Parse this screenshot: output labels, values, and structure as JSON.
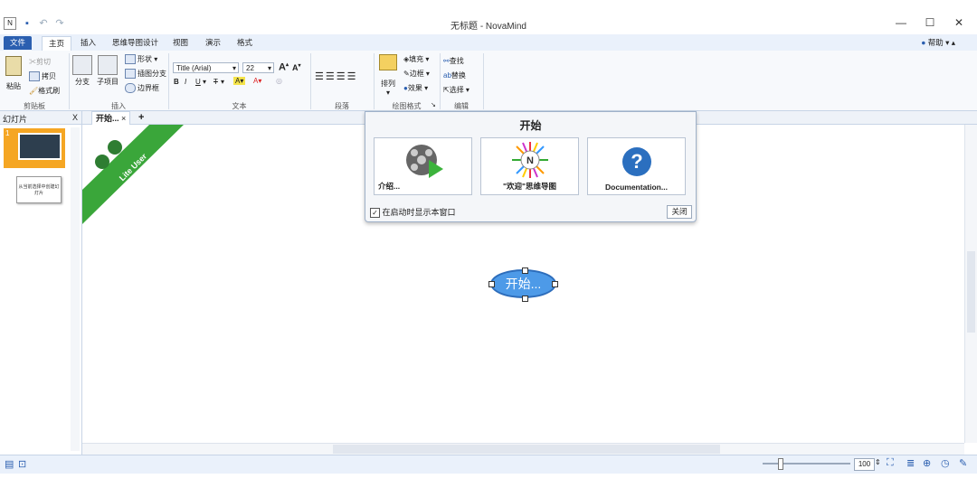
{
  "window": {
    "title": "无标题 - NovaMind"
  },
  "tabs": {
    "file": "文件",
    "home": "主页",
    "insert": "插入",
    "design": "思维导图设计",
    "view": "视图",
    "present": "演示",
    "format": "格式"
  },
  "help": "帮助",
  "clipboard": {
    "paste": "粘贴",
    "cut": "剪切",
    "copy": "拷贝",
    "format_painter": "格式刷",
    "group": "剪贴板"
  },
  "insert_grp": {
    "branch": "分支",
    "subitem": "子项目",
    "shape": "形状",
    "map_branch": "插图分支",
    "boundary": "边界框",
    "group": "插入"
  },
  "text_grp": {
    "font": "Title (Arial)",
    "size": "22",
    "bold": "B",
    "italic": "I",
    "underline": "U",
    "strike": "T",
    "group": "文本"
  },
  "paragraph_grp": {
    "group": "段落"
  },
  "draw_grp": {
    "arrange": "排列",
    "fill": "填充",
    "border": "边框",
    "effect": "效果",
    "group": "绘图格式"
  },
  "edit_grp": {
    "find": "查找",
    "replace": "替换",
    "select": "选择",
    "group": "编辑"
  },
  "left_panel": {
    "title": "幻灯片",
    "close": "X",
    "slide_num": "1",
    "thumb2_text": "从当前选择中创建幻灯片"
  },
  "doc_tab": {
    "label": "开始...",
    "close": "×",
    "add": "+"
  },
  "ribbon_banner": "Lite User",
  "start_dialog": {
    "title": "开始",
    "cards": [
      {
        "label": "介绍..."
      },
      {
        "label": "\"欢迎\"思维导图"
      },
      {
        "label": "Documentation..."
      }
    ],
    "checkbox_label": "在启动时显示本窗口",
    "close": "关闭"
  },
  "topic": {
    "label": "开始..."
  },
  "status": {
    "zoom": "100"
  }
}
